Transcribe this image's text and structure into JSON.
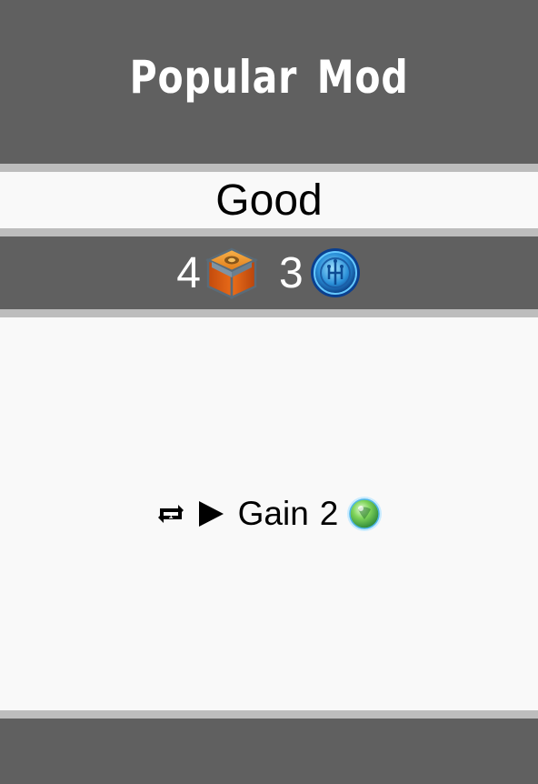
{
  "card": {
    "title": "Popular Mod",
    "type": "Good",
    "cost": [
      {
        "amount": "4",
        "icon": "crate-icon"
      },
      {
        "amount": "3",
        "icon": "tech-chip-icon"
      }
    ],
    "effect": {
      "trigger_icon": "repeat-once-icon",
      "arrow_icon": "play-arrow-icon",
      "text": "Gain",
      "amount": "2",
      "reward_icon": "green-orb-icon"
    }
  },
  "colors": {
    "band_dark": "#606060",
    "band_light": "#f9f9f9",
    "divider": "#bdbdbd",
    "title_text": "#ffffff"
  }
}
